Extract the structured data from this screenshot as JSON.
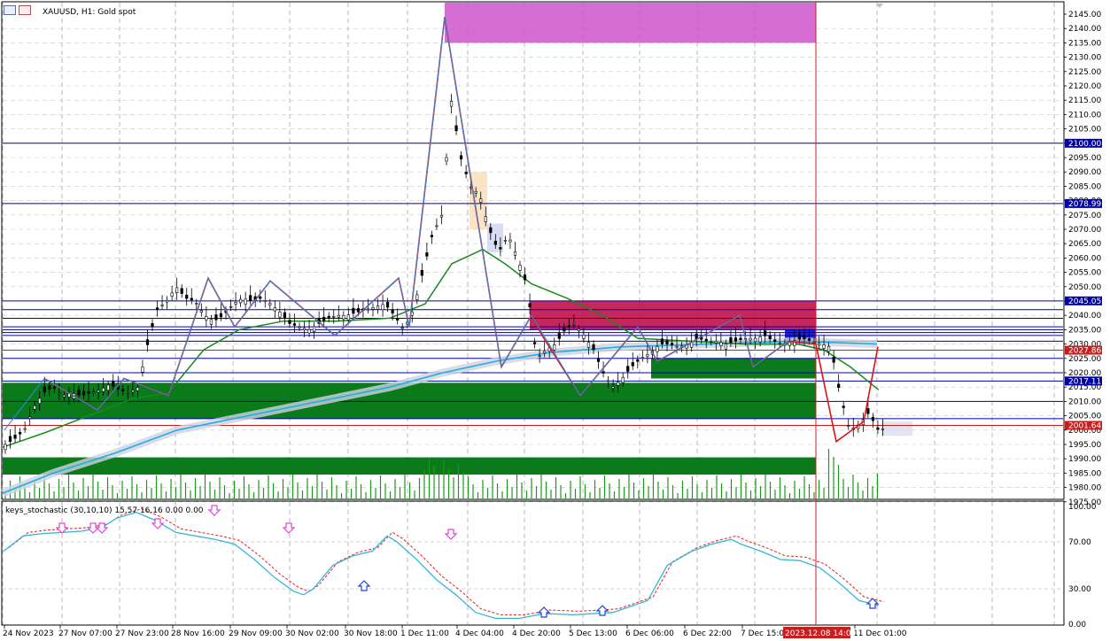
{
  "window": {
    "title": "XAUUSD, H1:  Gold spot",
    "indicator_title": "keys_stochastic (30,10,10) 15.57 16.16 0.00 0.00"
  },
  "colors": {
    "background": "#ffffff",
    "grid": "#9a9a9a",
    "price_line": "#c81e1e",
    "hline": "#0000aa",
    "green_zone": "#0a7a1a",
    "pink_zone": "#cc55cc",
    "crimson_zone": "#c0104a",
    "zigzag_red": "#e01010",
    "zigzag_blue": "#2a8ee0",
    "ma_green": "#1a8a1a",
    "ma_blue": "#22aaee",
    "stoch_main": "#36b6d6",
    "stoch_signal": "#dd2222",
    "arrow_up": "#2244cc",
    "arrow_down": "#dd44dd",
    "current_price_bg": "#c81e1e",
    "volume": "#1a9a1a"
  },
  "price_axis": {
    "labels": [
      "2145.00",
      "2140.00",
      "2135.00",
      "2130.00",
      "2125.00",
      "2120.00",
      "2115.00",
      "2110.00",
      "2105.00",
      "2100.00",
      "2095.00",
      "2090.00",
      "2085.00",
      "2080.00",
      "2075.00",
      "2070.00",
      "2065.00",
      "2060.00",
      "2055.00",
      "2050.00",
      "2045.00",
      "2040.00",
      "2035.00",
      "2030.00",
      "2025.00",
      "2020.00",
      "2015.00",
      "2010.00",
      "2005.00",
      "2000.00",
      "1995.00",
      "1990.00",
      "1985.00",
      "1980.00",
      "1975.00"
    ],
    "highlights": [
      {
        "price": "2100.00",
        "color": "#0000aa"
      },
      {
        "price": "2078.99",
        "color": "#0000aa"
      },
      {
        "price": "2045.05",
        "color": "#0000aa"
      },
      {
        "price": "2027.86",
        "color": "#c81e1e"
      },
      {
        "price": "2017.11",
        "color": "#0000aa"
      },
      {
        "price": "2001.64",
        "color": "#c81e1e"
      }
    ]
  },
  "stoch_axis": {
    "labels": [
      "100.00",
      "70.00",
      "30.00",
      "0.00"
    ]
  },
  "time_axis": {
    "labels": [
      "24 Nov 2023",
      "27 Nov 07:00",
      "27 Nov 23:00",
      "28 Nov 16:00",
      "29 Nov 09:00",
      "30 Nov 02:00",
      "30 Nov 18:00",
      "1 Dec 11:00",
      "4 Dec 04:00",
      "4 Dec 20:00",
      "5 Dec 13:00",
      "6 Dec 06:00",
      "6 Dec 22:00",
      "7 Dec 15:00",
      "11 Dec 01:00"
    ],
    "cursor_label": "2023.12.08 14:00"
  },
  "chart_data": [
    {
      "type": "candlestick",
      "title": "XAUUSD, H1:  Gold spot",
      "ylim": [
        1975,
        2147
      ],
      "close_path": [
        [
          0,
          1995
        ],
        [
          1,
          1997
        ],
        [
          2,
          2000
        ],
        [
          3,
          2008
        ],
        [
          4,
          2013
        ],
        [
          5,
          2015
        ],
        [
          6,
          2012
        ],
        [
          7,
          2013
        ],
        [
          8,
          2012
        ],
        [
          9,
          2013
        ],
        [
          10,
          2014
        ],
        [
          11,
          2016
        ],
        [
          12,
          2014
        ],
        [
          13,
          2013
        ],
        [
          14,
          2015
        ],
        [
          15,
          2030
        ],
        [
          16,
          2042
        ],
        [
          17,
          2045
        ],
        [
          18,
          2050
        ],
        [
          19,
          2046
        ],
        [
          20,
          2045
        ],
        [
          21,
          2040
        ],
        [
          22,
          2038
        ],
        [
          23,
          2040
        ],
        [
          24,
          2044
        ],
        [
          25,
          2046
        ],
        [
          26,
          2045
        ],
        [
          27,
          2046
        ],
        [
          28,
          2044
        ],
        [
          29,
          2041
        ],
        [
          30,
          2037
        ],
        [
          31,
          2036
        ],
        [
          32,
          2035
        ],
        [
          33,
          2037
        ],
        [
          34,
          2039
        ],
        [
          35,
          2040
        ],
        [
          36,
          2040
        ],
        [
          37,
          2041
        ],
        [
          38,
          2042
        ],
        [
          39,
          2043
        ],
        [
          40,
          2044
        ],
        [
          41,
          2040
        ],
        [
          42,
          2035
        ],
        [
          43,
          2042
        ],
        [
          44,
          2055
        ],
        [
          45,
          2068
        ],
        [
          46,
          2075
        ],
        [
          47,
          2115
        ],
        [
          48,
          2095
        ],
        [
          49,
          2085
        ],
        [
          50,
          2082
        ],
        [
          51,
          2070
        ],
        [
          52,
          2062
        ],
        [
          53,
          2068
        ],
        [
          54,
          2060
        ],
        [
          55,
          2050
        ],
        [
          56,
          2025
        ],
        [
          57,
          2028
        ],
        [
          58,
          2030
        ],
        [
          59,
          2035
        ],
        [
          60,
          2037
        ],
        [
          61,
          2033
        ],
        [
          62,
          2028
        ],
        [
          63,
          2020
        ],
        [
          64,
          2015
        ],
        [
          65,
          2018
        ],
        [
          66,
          2022
        ],
        [
          67,
          2025
        ],
        [
          68,
          2027
        ],
        [
          69,
          2030
        ],
        [
          70,
          2030
        ],
        [
          71,
          2029
        ],
        [
          72,
          2030
        ],
        [
          73,
          2032
        ],
        [
          74,
          2031
        ],
        [
          75,
          2031
        ],
        [
          76,
          2030
        ],
        [
          77,
          2031
        ],
        [
          78,
          2032
        ],
        [
          79,
          2032
        ],
        [
          80,
          2033
        ],
        [
          81,
          2031
        ],
        [
          82,
          2030
        ],
        [
          83,
          2031
        ],
        [
          84,
          2032
        ],
        [
          85,
          2031
        ],
        [
          86,
          2030
        ],
        [
          87,
          2029
        ],
        [
          88,
          2012
        ],
        [
          89,
          2000
        ],
        [
          90,
          2002
        ],
        [
          91,
          2006
        ],
        [
          92,
          2000
        ],
        [
          93,
          2001
        ]
      ],
      "horizontal_levels": [
        2100.0,
        2078.99,
        2045.05,
        2042,
        2039,
        2036,
        2035,
        2034,
        2033,
        2031,
        2027.86,
        2025,
        2020,
        2017.11,
        2010,
        2004,
        2001.64
      ],
      "current_price": 2001.64
    },
    {
      "type": "line",
      "title": "keys_stochastic (30,10,10) 15.57 16.16 0.00 0.00",
      "ylim": [
        0,
        100
      ],
      "series": [
        {
          "values": [
            [
              0,
              62
            ],
            [
              4,
              75
            ],
            [
              8,
              77
            ],
            [
              12,
              78
            ],
            [
              16,
              79
            ],
            [
              20,
              82
            ],
            [
              23,
              90
            ],
            [
              27,
              95
            ],
            [
              31,
              88
            ],
            [
              35,
              78
            ],
            [
              39,
              75
            ],
            [
              43,
              72
            ],
            [
              47,
              68
            ],
            [
              51,
              55
            ],
            [
              55,
              40
            ],
            [
              59,
              28
            ],
            [
              61,
              25
            ],
            [
              63,
              30
            ],
            [
              67,
              50
            ],
            [
              71,
              58
            ],
            [
              75,
              62
            ],
            [
              78,
              75
            ],
            [
              80,
              70
            ],
            [
              84,
              55
            ],
            [
              88,
              38
            ],
            [
              92,
              25
            ],
            [
              96,
              10
            ],
            [
              100,
              5
            ],
            [
              105,
              5
            ],
            [
              110,
              9
            ],
            [
              116,
              8
            ],
            [
              124,
              10
            ],
            [
              131,
              20
            ],
            [
              135,
              50
            ],
            [
              140,
              62
            ],
            [
              144,
              68
            ],
            [
              148,
              72
            ],
            [
              150,
              68
            ],
            [
              154,
              62
            ],
            [
              158,
              55
            ],
            [
              162,
              54
            ],
            [
              166,
              48
            ],
            [
              170,
              35
            ],
            [
              174,
              20
            ],
            [
              178,
              16
            ]
          ]
        }
      ],
      "values": {
        "main": 15.57,
        "signal": 16.16
      }
    }
  ]
}
